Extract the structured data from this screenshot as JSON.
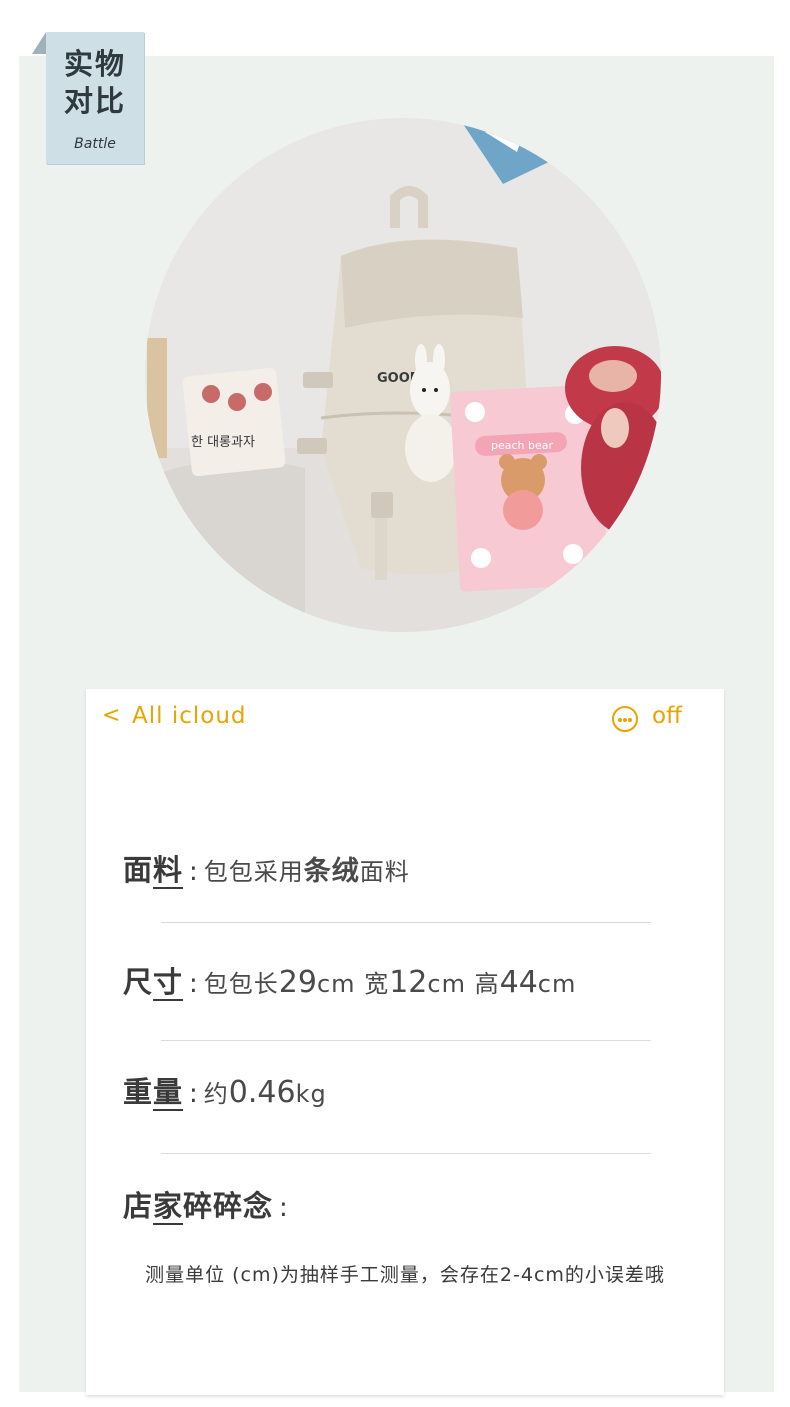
{
  "tag": {
    "title_line1": "实物",
    "title_line2": "对比",
    "subtitle": "Battle"
  },
  "photo": {
    "bag_text": "GOOD LI",
    "notebook_text": "peach bear",
    "snack_text": "한 대롱과자"
  },
  "topbar": {
    "back_label": "All icloud",
    "more_label": "off"
  },
  "specs": [
    {
      "key_a": "面",
      "key_b": "料",
      "colon": ":",
      "value_a": "包包采用",
      "value_strong": "条绒",
      "value_b": "面料"
    },
    {
      "key_a": "尺",
      "key_b": "寸",
      "colon": ":",
      "v1": "包包长",
      "n1": "29",
      "u1": "cm",
      "v2": "宽",
      "n2": "12",
      "u2": "cm",
      "v3": "高",
      "n3": "44",
      "u3": "cm"
    },
    {
      "key_a": "重",
      "key_b": "量",
      "colon": ":",
      "v1": "约",
      "n1": "0.46",
      "u1": "kg"
    },
    {
      "key_a": "店",
      "key_b": "家",
      "key_c": "碎碎念",
      "colon": ":"
    }
  ],
  "note": "测量单位 (cm)为抽样手工测量，会存在2-4cm的小误差哦",
  "colors": {
    "accent": "#e8a400",
    "panel": "#eef2ef",
    "tag": "#cfdfe6"
  }
}
